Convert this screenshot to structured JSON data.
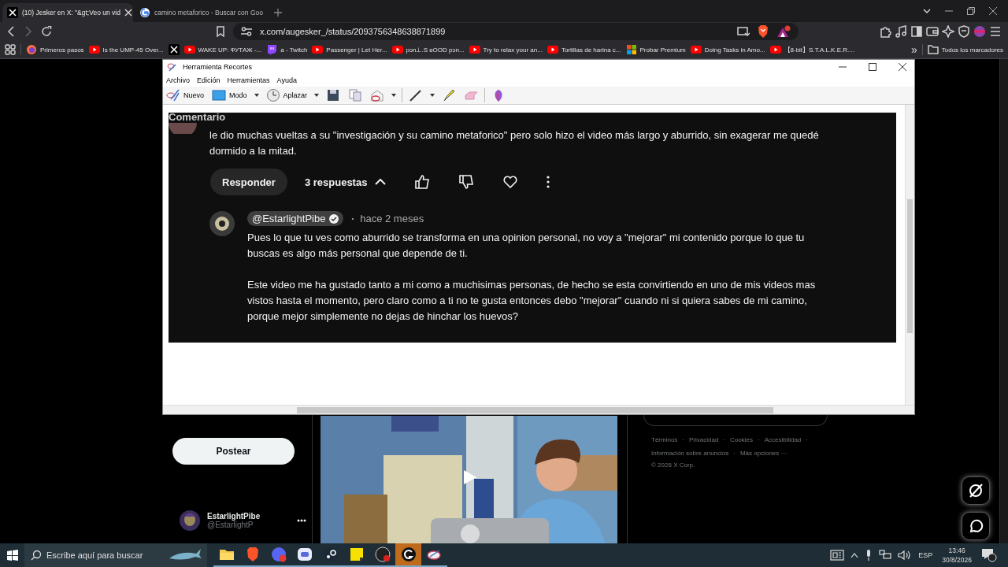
{
  "browser": {
    "tabs": [
      {
        "title": "(10) Jesker en X: \"&gt;Veo un vid",
        "kind": "x",
        "selected": true
      },
      {
        "title": "camino metaforico - Buscar con Goo",
        "kind": "google",
        "selected": false
      }
    ],
    "url": "x.com/augesker_/status/2093756348638871899",
    "bookmarks": [
      {
        "label": "Primeros pasos",
        "kind": "firefox"
      },
      {
        "label": "Is the UMP-45 Over...",
        "kind": "youtube"
      },
      {
        "kind": "x"
      },
      {
        "label": "WAKE UP: ФУТАЖ -...",
        "kind": "youtube"
      },
      {
        "label": "a - Twitch",
        "kind": "twitch"
      },
      {
        "label": "Passenger | Let Her...",
        "kind": "youtube"
      },
      {
        "label": "pɔn⊥.S ʁOOD pɔn...",
        "kind": "youtube"
      },
      {
        "label": "Try to relax your an...",
        "kind": "youtube"
      },
      {
        "label": "Tortillas de harina c...",
        "kind": "youtube"
      },
      {
        "label": "Probar Premium",
        "kind": "microsoft"
      },
      {
        "label": "Doing Tasks in Amo...",
        "kind": "youtube"
      },
      {
        "label": "【8-bit】S.T.A.L.K.E.R....",
        "kind": "youtube"
      }
    ],
    "more_bookmarks": "»",
    "all_bookmarks": "Todos los marcadores"
  },
  "snipping_tool": {
    "title": "Herramienta Recortes",
    "menu": [
      "Archivo",
      "Edición",
      "Herramientas",
      "Ayuda"
    ],
    "toolbar": [
      {
        "kind": "new",
        "label": "Nuevo"
      },
      {
        "kind": "mode",
        "label": "Modo"
      },
      {
        "kind": "delay",
        "label": "Aplazar"
      },
      {
        "kind": "save"
      },
      {
        "kind": "copy"
      },
      {
        "kind": "send"
      },
      {
        "kind": "pen"
      },
      {
        "kind": "highlighter"
      },
      {
        "kind": "eraser"
      },
      {
        "kind": "paint3d"
      }
    ],
    "capture": {
      "section_label": "Comentario",
      "parent_comment": {
        "text": "le dio muchas vueltas a su \"investigación y su camino metaforico\" pero solo hizo el video más largo y aburrido, sin exagerar me quedé dormido a la mitad.",
        "reply_button": "Responder",
        "replies": "3 respuestas",
        "expanded": true
      },
      "reply": {
        "author": "@EstarlightPibe",
        "verified": true,
        "separator": "•",
        "time": "hace 2 meses",
        "paragraphs": [
          "Pues lo que tu ves como aburrido se transforma en una opinion personal, no voy a \"mejorar\" mi contenido porque lo que tu buscas es algo más personal que depende de ti.",
          "Este video me ha gustado tanto a mi como a muchisimas personas, de hecho se esta convirtiendo en uno de mis videos mas vistos hasta el momento, pero claro como a ti no te gusta entonces debo \"mejorar\" cuando ni si quiera sabes de mi camino, porque mejor simplemente no dejas de hinchar los huevos?"
        ]
      }
    }
  },
  "page": {
    "post_button": "Postear",
    "account": {
      "name": "EstarlightPibe",
      "handle": "@EstarlightP"
    },
    "footer_separator": "·",
    "footer_links": [
      "Términos",
      "Privacidad",
      "Cookies",
      "Accesibilidad",
      "Información sobre anuncios",
      "Más opciones ···"
    ],
    "copyright": "© 2026 X Corp."
  },
  "taskbar": {
    "search_placeholder": "Escribe aquí para buscar",
    "apps": [
      {
        "kind": "explorer",
        "selected": false
      },
      {
        "kind": "brave",
        "selected": false
      },
      {
        "kind": "discord",
        "selected": false
      },
      {
        "kind": "app",
        "selected": false
      },
      {
        "kind": "steam",
        "selected": false
      },
      {
        "kind": "notes",
        "selected": false
      },
      {
        "kind": "obs",
        "selected": false
      },
      {
        "kind": "logitech",
        "selected": true
      },
      {
        "kind": "snip",
        "selected": false
      }
    ],
    "language": "ESP",
    "time": "13:46",
    "date": "30/8/2026"
  }
}
